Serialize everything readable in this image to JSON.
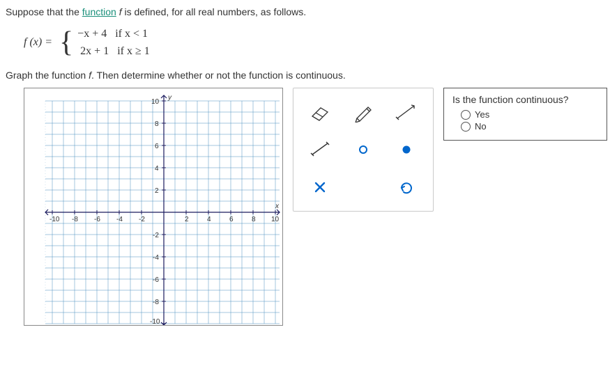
{
  "intro_pre": "Suppose that the ",
  "intro_link": "function",
  "intro_mid": " ",
  "intro_fname": "f",
  "intro_post": " is defined, for all real numbers, as follows.",
  "func": {
    "lhs": "f (x) = ",
    "case1": " −x + 4   if x < 1",
    "case2": "  2x + 1   if x ≥ 1"
  },
  "instruction_pre": "Graph the function ",
  "instruction_f": "f",
  "instruction_post": ". Then determine whether or not the function is continuous.",
  "answer": {
    "question": "Is the function continuous?",
    "yes": "Yes",
    "no": "No"
  },
  "axis": {
    "y_label": "y",
    "x_label": "x"
  }
}
